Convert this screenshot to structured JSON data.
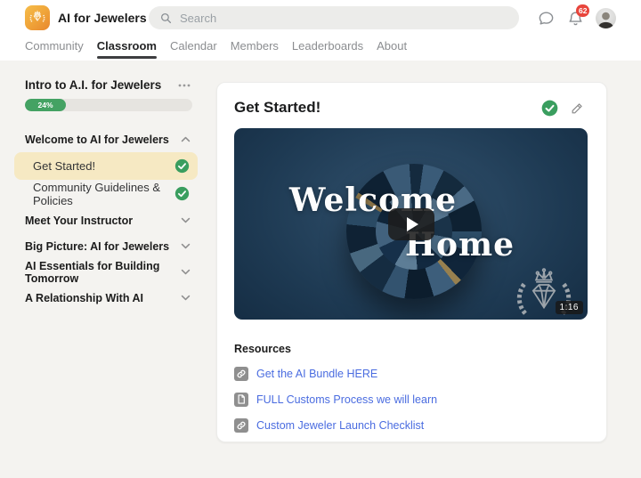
{
  "header": {
    "community_name": "AI for Jewelers",
    "search_placeholder": "Search",
    "notification_count": "62"
  },
  "nav": {
    "tabs": [
      {
        "label": "Community",
        "active": false
      },
      {
        "label": "Classroom",
        "active": true
      },
      {
        "label": "Calendar",
        "active": false
      },
      {
        "label": "Members",
        "active": false
      },
      {
        "label": "Leaderboards",
        "active": false
      },
      {
        "label": "About",
        "active": false
      }
    ]
  },
  "sidebar": {
    "course_title": "Intro to A.I. for Jewelers",
    "progress_label": "24%",
    "progress_value": 24,
    "sections": [
      {
        "title": "Welcome to AI for Jewelers",
        "expanded": true,
        "lessons": [
          {
            "label": "Get Started!",
            "completed": true,
            "active": true
          },
          {
            "label": "Community Guidelines & Policies",
            "completed": true,
            "active": false
          }
        ]
      },
      {
        "title": "Meet Your Instructor",
        "expanded": false
      },
      {
        "title": "Big Picture: AI for Jewelers",
        "expanded": false
      },
      {
        "title": "AI Essentials for Building Tomorrow",
        "expanded": false
      },
      {
        "title": "A Relationship With AI",
        "expanded": false
      }
    ]
  },
  "main": {
    "lesson_title": "Get Started!",
    "video": {
      "overlay_title_line1": "Welcome",
      "overlay_title_line2": "Home",
      "duration": "1:16"
    },
    "resources": {
      "heading": "Resources",
      "links": [
        {
          "label": "Get the AI Bundle HERE",
          "icon": "link"
        },
        {
          "label": "FULL Customs Process we will learn",
          "icon": "file"
        },
        {
          "label": "Custom Jeweler Launch Checklist",
          "icon": "link"
        }
      ]
    }
  },
  "colors": {
    "accent_green": "#3a9e5f",
    "highlight_yellow": "#f6e9c3",
    "link_blue": "#4a6ce0",
    "badge_red": "#e8453c",
    "brand_orange": "#efa238"
  }
}
